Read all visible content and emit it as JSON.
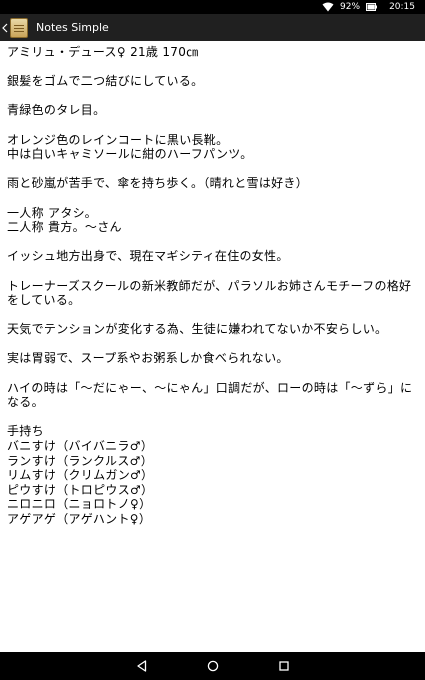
{
  "status_bar": {
    "battery": "92%",
    "time": "20:15"
  },
  "app_bar": {
    "title": "Notes Simple"
  },
  "note": {
    "text": "アミリュ・デュース♀ 21歳 170㎝\n\n銀髪をゴムで二つ結びにしている。\n\n青緑色のタレ目。\n\nオレンジ色のレインコートに黒い長靴。\n中は白いキャミソールに紺のハーフパンツ。\n\n雨と砂嵐が苦手で、傘を持ち歩く。（晴れと雪は好き）\n\n一人称 アタシ。\n二人称 貴方。〜さん\n\nイッシュ地方出身で、現在マギシティ在住の女性。\n\nトレーナーズスクールの新米教師だが、パラソルお姉さんモチーフの格好をしている。\n\n天気でテンションが変化する為、生徒に嫌われてないか不安らしい。\n\n実は胃弱で、スープ系やお粥系しか食べられない。\n\nハイの時は「〜だにゃー、〜にゃん」口調だが、ローの時は「〜ずら」になる。\n\n手持ち\nバニすけ（バイバニラ♂）\nランすけ（ランクルス♂）\nリムすけ（クリムガン♂）\nピウすけ（トロピウス♂）\nニロニロ（ニョロトノ♀）\nアゲアゲ（アゲハント♀）"
  },
  "icons": {
    "wifi": "wifi-icon",
    "battery": "battery-icon",
    "back": "back-chevron-icon",
    "app": "notes-app-icon",
    "nav_back": "triangle-back-icon",
    "nav_home": "circle-home-icon",
    "nav_recents": "square-recents-icon"
  }
}
